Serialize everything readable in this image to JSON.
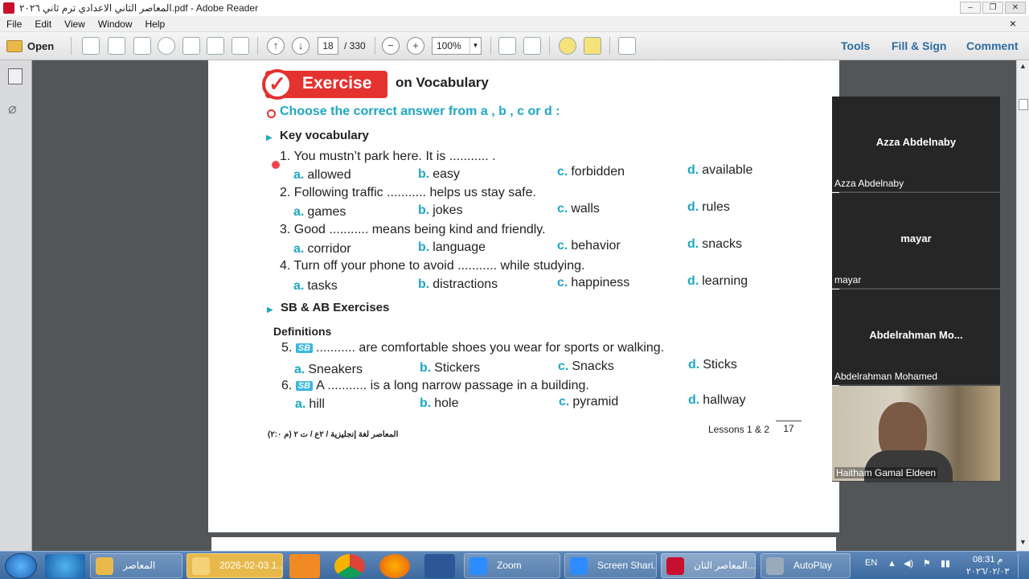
{
  "window": {
    "title": "المعاصر الثاني الاعدادي ترم ثاني ٢٠٢٦.pdf - Adobe Reader"
  },
  "menu": [
    "File",
    "Edit",
    "View",
    "Window",
    "Help"
  ],
  "toolbar": {
    "open_label": "Open",
    "page_current": "18",
    "page_total": "/ 330",
    "zoom": "100%",
    "tools": "Tools",
    "fill_sign": "Fill & Sign",
    "comment": "Comment"
  },
  "doc": {
    "badge": "Exercise",
    "badge_sub": "on Vocabulary",
    "instruction": "Choose the correct answer from a , b , c or d :",
    "section1": "Key vocabulary",
    "questions": [
      {
        "q": "1. You mustn’t park here. It is ........... .",
        "a": "allowed",
        "b": "easy",
        "c": "forbidden",
        "d": "available"
      },
      {
        "q": "2. Following traffic ........... helps us stay safe.",
        "a": "games",
        "b": "jokes",
        "c": "walls",
        "d": "rules"
      },
      {
        "q": "3. Good ........... means being kind and friendly.",
        "a": "corridor",
        "b": "language",
        "c": "behavior",
        "d": "snacks"
      },
      {
        "q": "4. Turn off your phone to avoid ........... while studying.",
        "a": "tasks",
        "b": "distractions",
        "c": "happiness",
        "d": "learning"
      }
    ],
    "section2": "SB & AB Exercises",
    "definitions": "Definitions",
    "sb_tag": "SB",
    "q5": {
      "num": "5.",
      "text": "........... are comfortable shoes you wear for sports or walking.",
      "a": "Sneakers",
      "b": "Stickers",
      "c": "Snacks",
      "d": "Sticks"
    },
    "q6": {
      "num": "6.",
      "text": "A ........... is a long narrow passage in a building.",
      "a": "hill",
      "b": "hole",
      "c": "pyramid",
      "d": "hallway"
    },
    "letters": {
      "a": "a.",
      "b": "b.",
      "c": "c.",
      "d": "d."
    },
    "footer_left": "المعاصر لغة إنجليزية / ٢ع / ت ٢ (م ٢:٠)",
    "footer_right": "Lessons 1 & 2",
    "page_number": "17"
  },
  "participants": [
    {
      "name": "Azza Abdelnaby",
      "label": "Azza Abdelnaby"
    },
    {
      "name": "mayar",
      "label": "mayar"
    },
    {
      "name": "Abdelrahman  Mo...",
      "label": "Abdelrahman Mohamed"
    },
    {
      "name": "",
      "label": "Haitham Gamal Eldeen"
    }
  ],
  "taskbar": {
    "items": [
      "المعاصر",
      "2026-02-03 1...",
      "Zoom",
      "Screen Shari...",
      "المعاصر الثان...",
      "AutoPlay"
    ],
    "lang": "EN",
    "time": "08:31 م",
    "date": "٢٠٢٦/٠٢/٠٣"
  },
  "colors": {
    "accent": "#e4322f",
    "cyan": "#1fa7c4",
    "toolbar_link": "#2d6ca2"
  }
}
